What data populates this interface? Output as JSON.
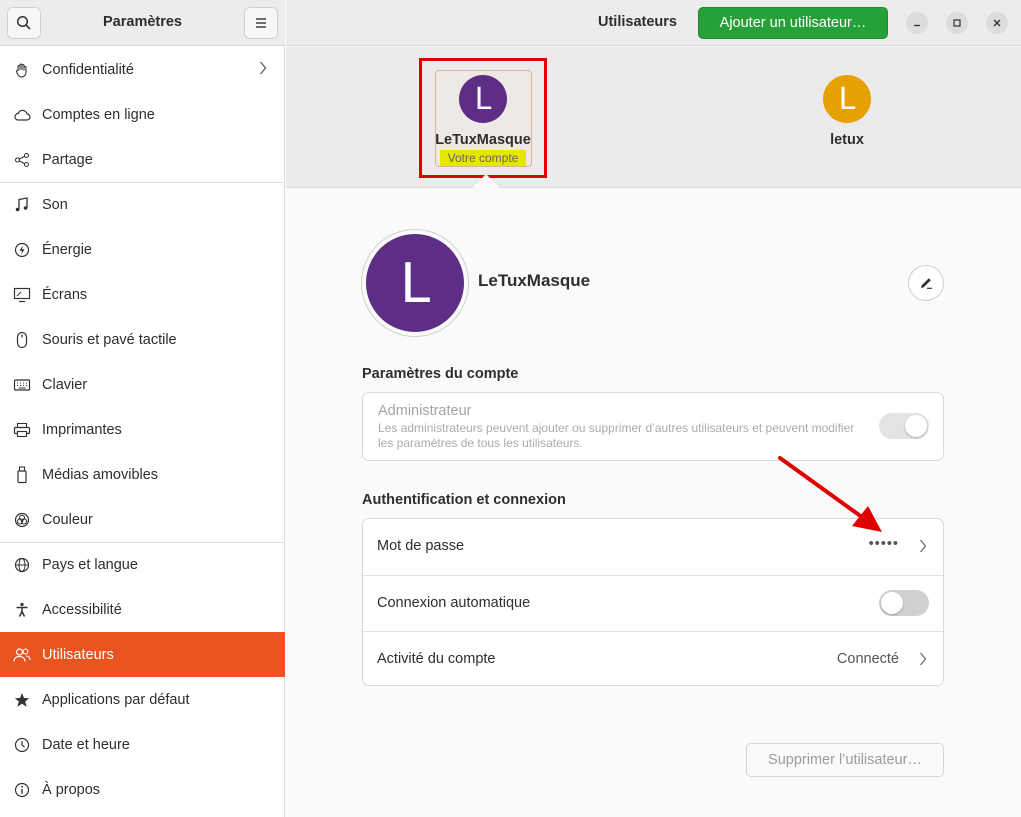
{
  "sidebar": {
    "title": "Paramètres",
    "items": [
      {
        "label": "Confidentialité",
        "icon": "hand-icon",
        "chevron": true
      },
      {
        "label": "Comptes en ligne",
        "icon": "cloud-icon"
      },
      {
        "label": "Partage",
        "icon": "share-icon"
      },
      {
        "label": "Son",
        "icon": "music-note-icon"
      },
      {
        "label": "Énergie",
        "icon": "power-icon"
      },
      {
        "label": "Écrans",
        "icon": "display-icon"
      },
      {
        "label": "Souris et pavé tactile",
        "icon": "mouse-icon"
      },
      {
        "label": "Clavier",
        "icon": "keyboard-icon"
      },
      {
        "label": "Imprimantes",
        "icon": "printer-icon"
      },
      {
        "label": "Médias amovibles",
        "icon": "usb-drive-icon"
      },
      {
        "label": "Couleur",
        "icon": "color-icon"
      },
      {
        "label": "Pays et langue",
        "icon": "globe-icon"
      },
      {
        "label": "Accessibilité",
        "icon": "accessibility-icon"
      },
      {
        "label": "Utilisateurs",
        "icon": "users-icon",
        "active": true
      },
      {
        "label": "Applications par défaut",
        "icon": "star-icon"
      },
      {
        "label": "Date et heure",
        "icon": "clock-icon"
      },
      {
        "label": "À propos",
        "icon": "info-icon"
      }
    ]
  },
  "header": {
    "title": "Utilisateurs",
    "add_user_label": "Ajouter un utilisateur…"
  },
  "users": [
    {
      "initial": "L",
      "name": "LeTuxMasque",
      "badge": "Votre compte",
      "color": "#5e2e86",
      "selected": true
    },
    {
      "initial": "L",
      "name": "letux",
      "color": "#e6a000"
    }
  ],
  "profile": {
    "initial": "L",
    "name": "LeTuxMasque"
  },
  "account_settings": {
    "title": "Paramètres du compte",
    "admin_title": "Administrateur",
    "admin_desc": "Les administrateurs peuvent ajouter ou supprimer d’autres utilisateurs et peuvent modifier les paramètres de tous les utilisateurs.",
    "admin_enabled": true
  },
  "auth": {
    "title": "Authentification et connexion",
    "password_label": "Mot de passe",
    "password_value": "•••••",
    "autologin_label": "Connexion automatique",
    "autologin_enabled": false,
    "activity_label": "Activité du compte",
    "activity_value": "Connecté"
  },
  "delete_user_label": "Supprimer l’utilisateur…",
  "colors": {
    "accent": "#e95420",
    "add_button": "#26a13a",
    "annotation": "#e00000",
    "highlight": "#e6e600"
  }
}
